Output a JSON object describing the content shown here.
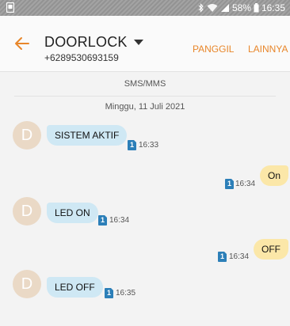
{
  "status_bar": {
    "battery": "58%",
    "time": "16:35"
  },
  "header": {
    "contact_name": "DOORLOCK",
    "contact_number": "+6289530693159",
    "call_label": "PANGGIL",
    "more_label": "LAINNYA"
  },
  "thread": {
    "channel": "SMS/MMS",
    "date": "Minggu, 11 Juli 2021",
    "avatar_letter": "D",
    "sim_label": "1",
    "messages": [
      {
        "direction": "incoming",
        "text": "SISTEM AKTIF",
        "time": "16:33"
      },
      {
        "direction": "outgoing",
        "text": "On",
        "time": "16:34"
      },
      {
        "direction": "incoming",
        "text": "LED ON",
        "time": "16:34"
      },
      {
        "direction": "outgoing",
        "text": "OFF",
        "time": "16:34"
      },
      {
        "direction": "incoming",
        "text": "LED OFF",
        "time": "16:35"
      }
    ]
  },
  "colors": {
    "accent": "#e8862a",
    "incoming_bubble": "#cfe8f4",
    "outgoing_bubble": "#fbe7a8",
    "avatar": "#ead9c6",
    "sim_badge": "#2c7fb8"
  },
  "icons": {
    "status_left": "notification-icon",
    "bluetooth": "bluetooth-icon",
    "wifi": "wifi-icon",
    "signal": "signal-icon",
    "battery": "battery-icon",
    "back": "back-arrow-icon",
    "dropdown": "chevron-down-icon"
  }
}
